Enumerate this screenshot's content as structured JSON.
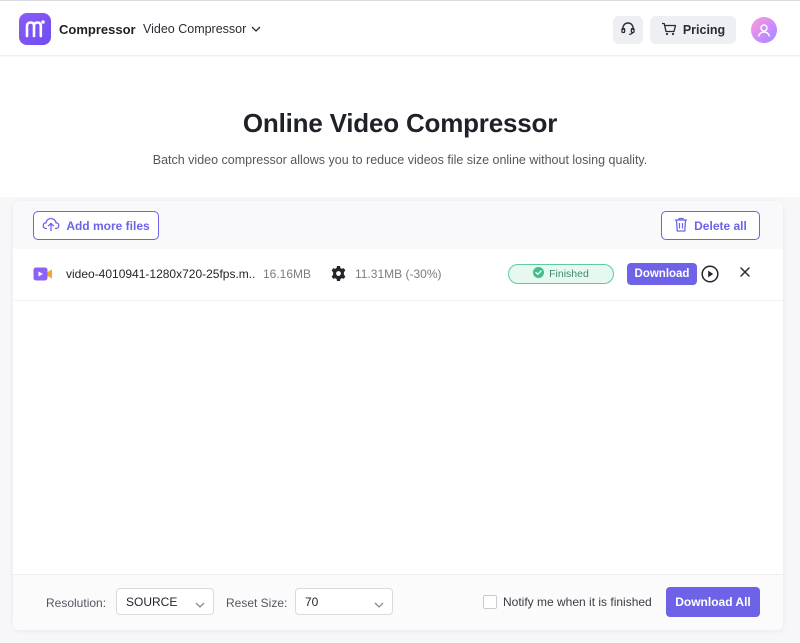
{
  "header": {
    "brand": "Compressor",
    "nav_menu_label": "Video Compressor",
    "pricing_label": "Pricing"
  },
  "hero": {
    "title": "Online Video Compressor",
    "subtitle": "Batch video compressor allows you to reduce videos file size online without losing quality."
  },
  "toolbar": {
    "add_files_label": "Add more files",
    "delete_all_label": "Delete all"
  },
  "files": [
    {
      "name": "video-4010941-1280x720-25fps.m...",
      "original_size": "16.16MB",
      "compressed_size": "11.31MB (-30%)",
      "status": "Finished",
      "download_label": "Download"
    }
  ],
  "bottom_bar": {
    "resolution_label": "Resolution:",
    "resolution_value": "SOURCE",
    "reset_size_label": "Reset Size:",
    "reset_size_value": "70",
    "notify_label": "Notify me when it is finished",
    "notify_checked": false,
    "download_all_label": "Download All"
  },
  "colors": {
    "accent": "#6e63e6",
    "success": "#5ccba0",
    "success_bg": "#e7f8f1"
  },
  "icons": {
    "logo": "media-io-logo-icon",
    "nav_chevron": "chevron-down-icon",
    "support": "headset-icon",
    "pricing": "cart-icon",
    "avatar": "user-avatar-icon",
    "add_files": "cloud-upload-icon",
    "delete_all": "trash-icon",
    "file_type": "video-file-icon",
    "settings": "gear-icon",
    "status": "check-circle-icon",
    "play": "play-circle-icon",
    "remove": "close-icon"
  }
}
